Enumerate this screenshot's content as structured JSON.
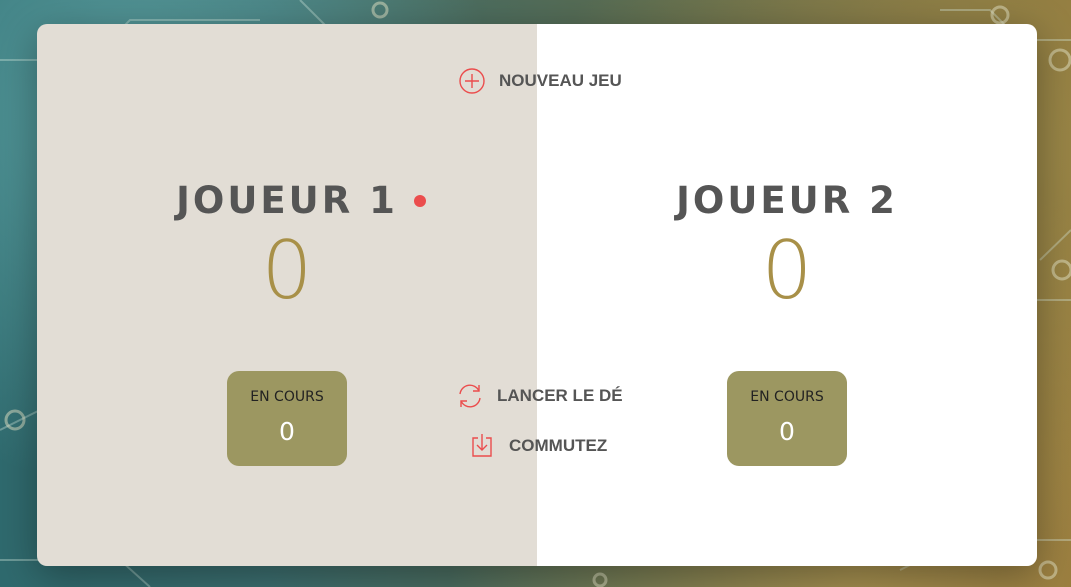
{
  "buttons": {
    "new_game": "NOUVEAU JEU",
    "roll_dice": "LANCER LE DÉ",
    "hold": "COMMUTEZ"
  },
  "players": [
    {
      "name": "JOUEUR 1",
      "score": "0",
      "current_label": "EN COURS",
      "current_score": "0",
      "active": true
    },
    {
      "name": "JOUEUR 2",
      "score": "0",
      "current_label": "EN COURS",
      "current_score": "0",
      "active": false
    }
  ],
  "icons": {
    "new_game": "plus-circle-icon",
    "roll_dice": "refresh-icon",
    "hold": "download-icon",
    "active_player": "active-dot-icon"
  },
  "colors": {
    "active_panel": "#e2ddd5",
    "inactive_panel": "#ffffff",
    "accent_red": "#eb4d4d",
    "score": "#a89048",
    "current_box": "#9c9761",
    "text": "#555555"
  }
}
